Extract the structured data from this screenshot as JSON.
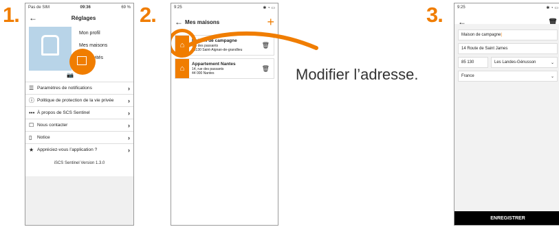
{
  "steps": [
    "1.",
    "2.",
    "3."
  ],
  "caption": "Modifier l’adresse.",
  "phone1": {
    "status": {
      "left": "Pas de SIM",
      "time": "09:36",
      "battery": "69 %"
    },
    "title": "Réglages",
    "profile_menu": [
      "Mon profil",
      "Mes maisons",
      "Mes invités"
    ],
    "items": [
      {
        "icon": "sliders-icon",
        "glyph": "☰",
        "label": "Paramètres de notifications"
      },
      {
        "icon": "info-icon",
        "glyph": "ⓘ",
        "label": "Politique de protection de la vie privée"
      },
      {
        "icon": "dots-icon",
        "glyph": "•••",
        "label": "À propos de SCS Sentinel"
      },
      {
        "icon": "message-icon",
        "glyph": "☐",
        "label": "Nous contacter"
      },
      {
        "icon": "document-icon",
        "glyph": "▯",
        "label": "Notice"
      },
      {
        "icon": "star-icon",
        "glyph": "★",
        "label": "Appréciez-vous l’application ?"
      }
    ],
    "version": "iSCS Sentinel Version 1.3.0"
  },
  "phone2": {
    "status": {
      "time": "9:25"
    },
    "title": "Mes maisons",
    "houses": [
      {
        "name": "Maison de campagne",
        "line1": "rue des passants",
        "line2": "85130 Saint-Aignan-de-grandlieu"
      },
      {
        "name": "Appartement Nantes",
        "line1": "14, rue des passants",
        "line2": "44 000 Nantes"
      }
    ]
  },
  "phone3": {
    "status": {
      "time": "9:25"
    },
    "name_field": "Maison de campagne",
    "street_field": "14 Route de Saint James",
    "postcode_field": "85 130",
    "city_field": "Les Landes-Génusson",
    "country_field": "France",
    "save_label": "ENREGISTRER"
  },
  "colors": {
    "accent": "#f07d00"
  }
}
